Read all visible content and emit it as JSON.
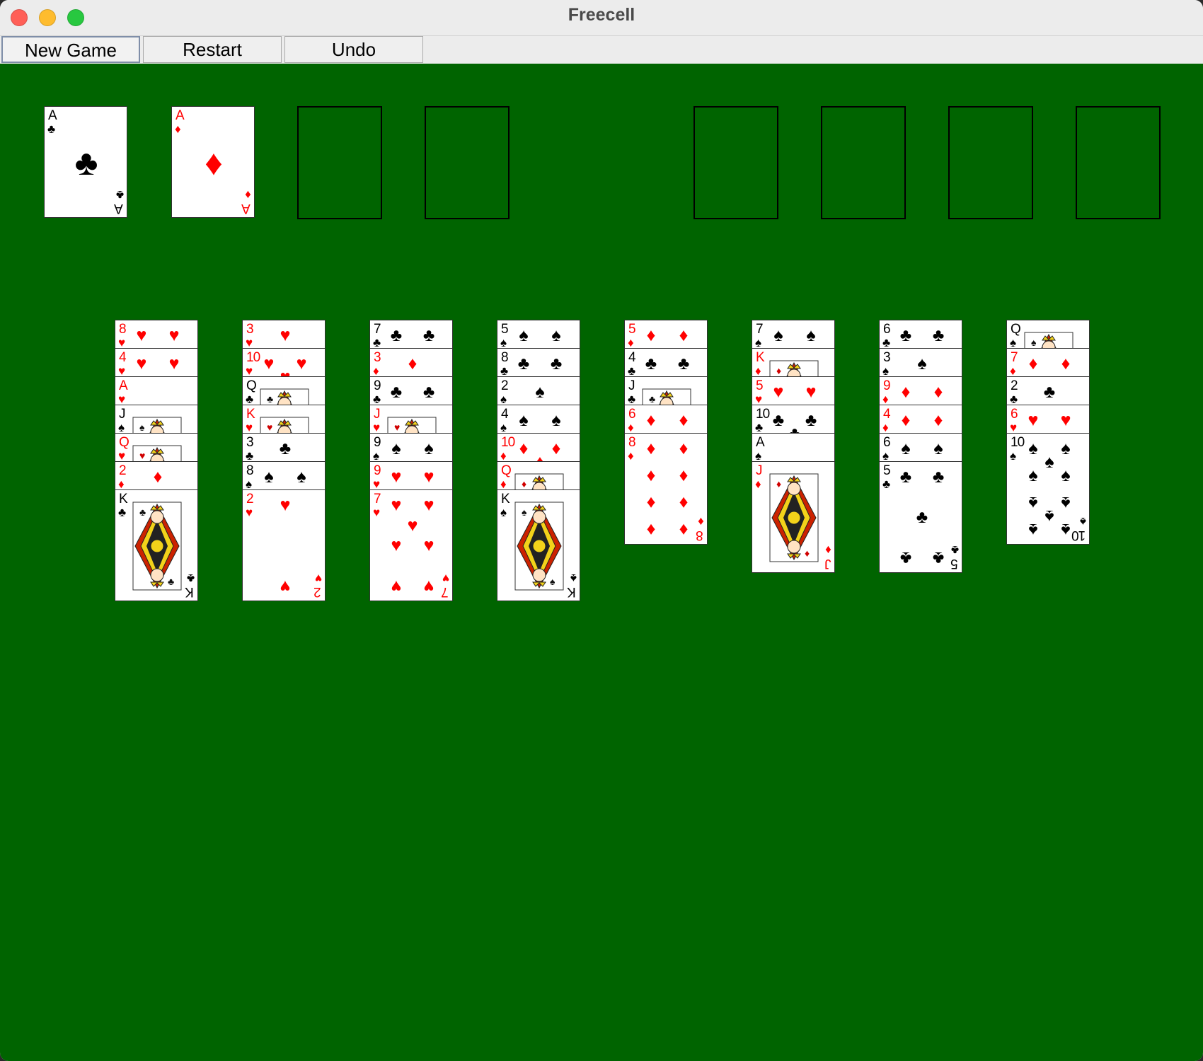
{
  "window": {
    "title": "Freecell",
    "traffic_lights": {
      "close_color": "#ff5f57",
      "minimize_color": "#febc2e",
      "zoom_color": "#28c840"
    }
  },
  "toolbar": {
    "new_game_label": "New Game",
    "restart_label": "Restart",
    "undo_label": "Undo"
  },
  "table_color": "#006400",
  "suits": {
    "clubs": {
      "glyph": "♣",
      "color": "black"
    },
    "spades": {
      "glyph": "♠",
      "color": "black"
    },
    "hearts": {
      "glyph": "♥",
      "color": "red"
    },
    "diamonds": {
      "glyph": "♦",
      "color": "red"
    }
  },
  "top_left_cells": [
    {
      "rank": "A",
      "suit": "clubs"
    },
    {
      "rank": "A",
      "suit": "diamonds"
    },
    null,
    null
  ],
  "top_right_cells": [
    null,
    null,
    null,
    null
  ],
  "tableau": [
    [
      {
        "rank": "8",
        "suit": "hearts"
      },
      {
        "rank": "4",
        "suit": "hearts"
      },
      {
        "rank": "A",
        "suit": "hearts"
      },
      {
        "rank": "J",
        "suit": "spades"
      },
      {
        "rank": "Q",
        "suit": "hearts"
      },
      {
        "rank": "2",
        "suit": "diamonds"
      },
      {
        "rank": "K",
        "suit": "clubs"
      }
    ],
    [
      {
        "rank": "3",
        "suit": "hearts"
      },
      {
        "rank": "10",
        "suit": "hearts"
      },
      {
        "rank": "Q",
        "suit": "clubs"
      },
      {
        "rank": "K",
        "suit": "hearts"
      },
      {
        "rank": "3",
        "suit": "clubs"
      },
      {
        "rank": "8",
        "suit": "spades"
      },
      {
        "rank": "2",
        "suit": "hearts"
      }
    ],
    [
      {
        "rank": "7",
        "suit": "clubs"
      },
      {
        "rank": "3",
        "suit": "diamonds"
      },
      {
        "rank": "9",
        "suit": "clubs"
      },
      {
        "rank": "J",
        "suit": "hearts"
      },
      {
        "rank": "9",
        "suit": "spades"
      },
      {
        "rank": "9",
        "suit": "hearts"
      },
      {
        "rank": "7",
        "suit": "hearts"
      }
    ],
    [
      {
        "rank": "5",
        "suit": "spades"
      },
      {
        "rank": "8",
        "suit": "clubs"
      },
      {
        "rank": "2",
        "suit": "spades"
      },
      {
        "rank": "4",
        "suit": "spades"
      },
      {
        "rank": "10",
        "suit": "diamonds"
      },
      {
        "rank": "Q",
        "suit": "diamonds"
      },
      {
        "rank": "K",
        "suit": "spades"
      }
    ],
    [
      {
        "rank": "5",
        "suit": "diamonds"
      },
      {
        "rank": "4",
        "suit": "clubs"
      },
      {
        "rank": "J",
        "suit": "clubs"
      },
      {
        "rank": "6",
        "suit": "diamonds"
      },
      {
        "rank": "8",
        "suit": "diamonds"
      }
    ],
    [
      {
        "rank": "7",
        "suit": "spades"
      },
      {
        "rank": "K",
        "suit": "diamonds"
      },
      {
        "rank": "5",
        "suit": "hearts"
      },
      {
        "rank": "10",
        "suit": "clubs"
      },
      {
        "rank": "A",
        "suit": "spades"
      },
      {
        "rank": "J",
        "suit": "diamonds"
      }
    ],
    [
      {
        "rank": "6",
        "suit": "clubs"
      },
      {
        "rank": "3",
        "suit": "spades"
      },
      {
        "rank": "9",
        "suit": "diamonds"
      },
      {
        "rank": "4",
        "suit": "diamonds"
      },
      {
        "rank": "6",
        "suit": "spades"
      },
      {
        "rank": "5",
        "suit": "clubs"
      }
    ],
    [
      {
        "rank": "Q",
        "suit": "spades"
      },
      {
        "rank": "7",
        "suit": "diamonds"
      },
      {
        "rank": "2",
        "suit": "clubs"
      },
      {
        "rank": "6",
        "suit": "hearts"
      },
      {
        "rank": "10",
        "suit": "spades"
      }
    ]
  ]
}
